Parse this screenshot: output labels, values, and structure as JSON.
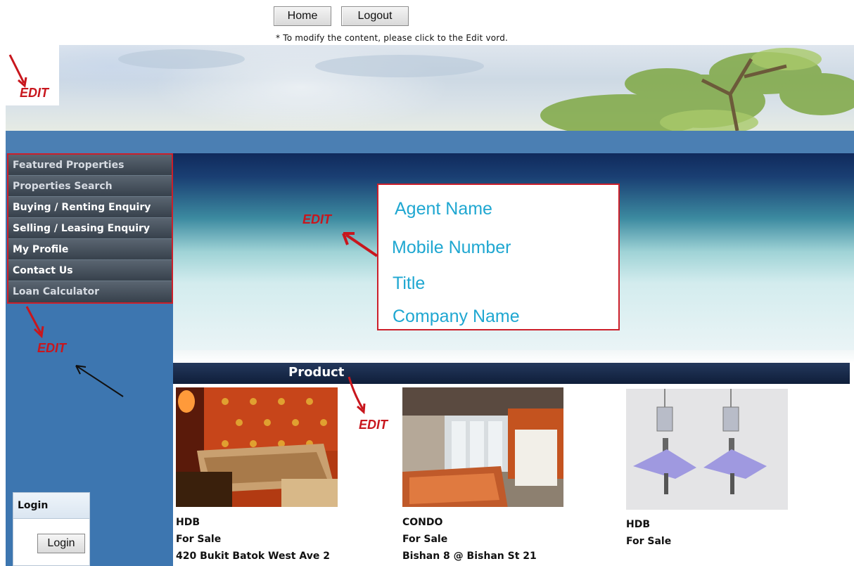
{
  "topbar": {
    "home_label": "Home",
    "logout_label": "Logout",
    "note": "* To modify the content, please click to the Edit vord."
  },
  "edit_markers": {
    "header": "EDIT",
    "hero": "EDIT",
    "sidebar": "EDIT",
    "product": "EDIT"
  },
  "sidebar": {
    "items": [
      {
        "label": "Featured Properties"
      },
      {
        "label": "Properties Search"
      },
      {
        "label": "Buying / Renting Enquiry"
      },
      {
        "label": "Selling / Leasing Enquiry"
      },
      {
        "label": "My Profile"
      },
      {
        "label": "Contact Us"
      },
      {
        "label": "Loan Calculator"
      }
    ]
  },
  "agent": {
    "name": "Agent Name",
    "mobile": "Mobile Number",
    "title": "Title",
    "company": "Company Name"
  },
  "products": {
    "heading": "Product",
    "items": [
      {
        "type": "HDB",
        "status": "For Sale",
        "address": "420 Bukit Batok West Ave 2"
      },
      {
        "type": "CONDO",
        "status": "For Sale",
        "address": "Bishan 8 @ Bishan St 21"
      },
      {
        "type": "HDB",
        "status": "For Sale",
        "address": ""
      }
    ]
  },
  "login": {
    "heading": "Login",
    "button_label": "Login"
  }
}
